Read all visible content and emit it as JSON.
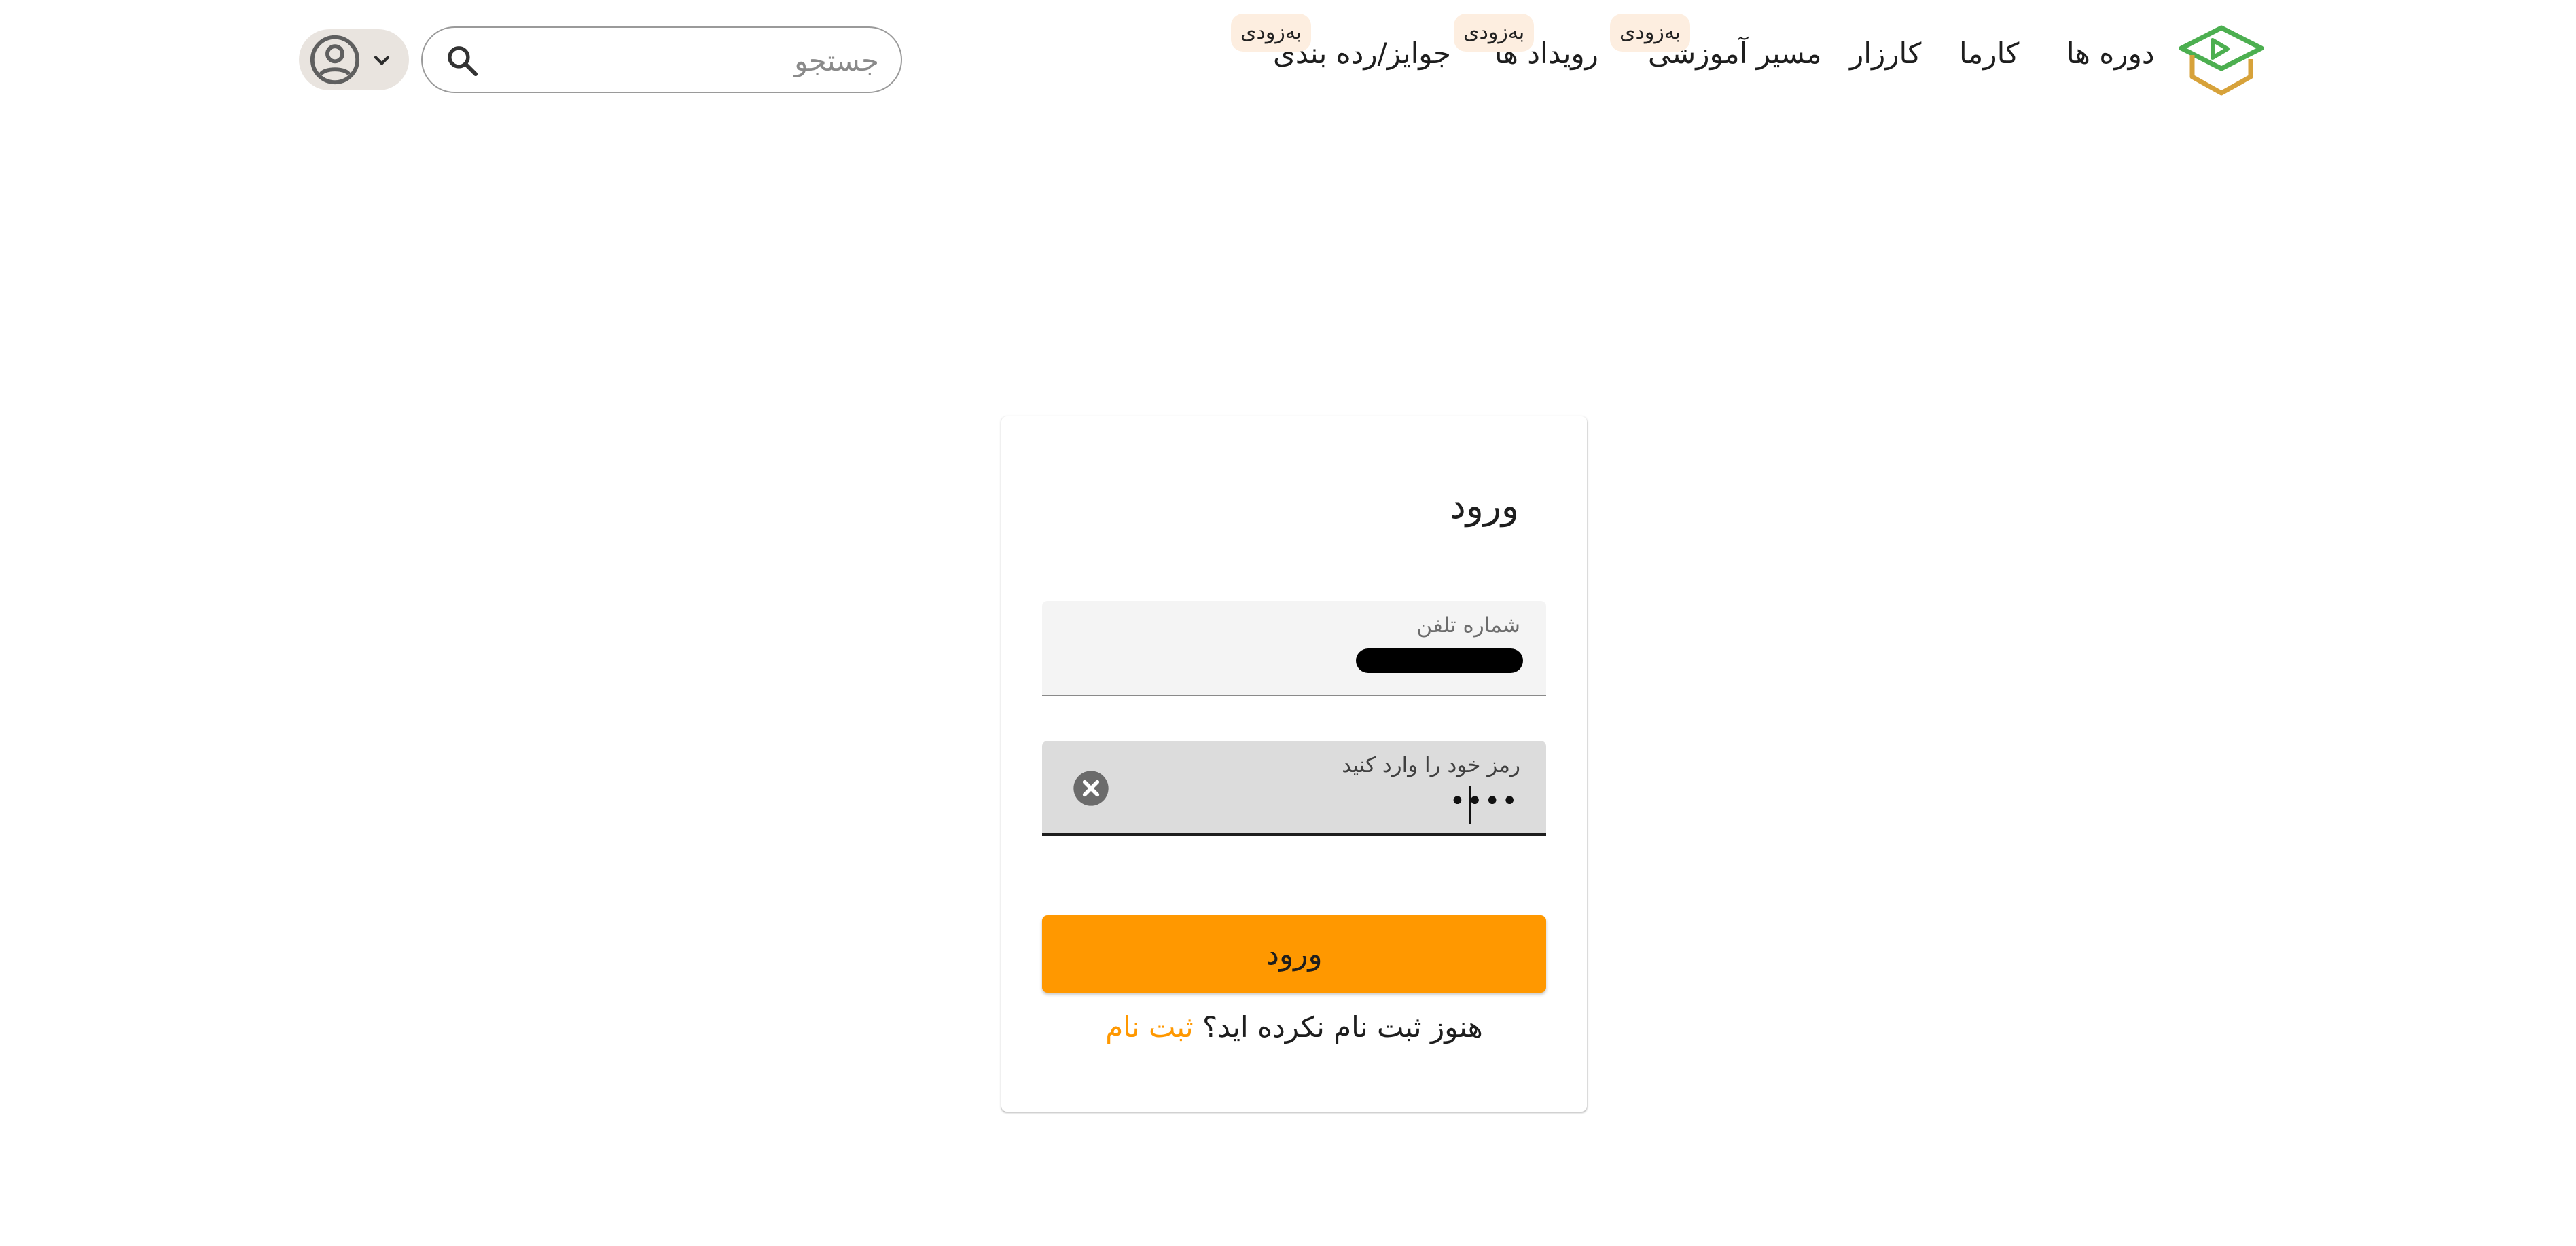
{
  "header": {
    "logo_colors": {
      "green": "#4caf50",
      "amber": "#d7a23a"
    },
    "nav": [
      {
        "label": "دوره ها"
      },
      {
        "label": "کارما"
      },
      {
        "label": "کارزار"
      },
      {
        "label": "مسیر آموزشی",
        "badge": "به‌زودی"
      },
      {
        "label": "رویداد ها",
        "badge": "به‌زودی"
      },
      {
        "label": "جوایز/رده بندی",
        "badge": "به‌زودی"
      }
    ],
    "search": {
      "placeholder": "جستجو",
      "icon": "search-icon"
    },
    "user_menu": {
      "icon": "account-circle-icon",
      "chevron": "chevron-down-icon"
    }
  },
  "login": {
    "title": "ورود",
    "phone_label": "شماره تلفن",
    "password_label": "رمز خود را وارد کنید",
    "password_value": "••••",
    "submit_label": "ورود",
    "signup_prompt": "هنوز ثبت نام نکرده اید؟",
    "signup_link": "ثبت نام"
  },
  "colors": {
    "accent": "#ff9800",
    "badge_bg": "#fdeee0",
    "user_menu_bg": "#e9e4df"
  }
}
